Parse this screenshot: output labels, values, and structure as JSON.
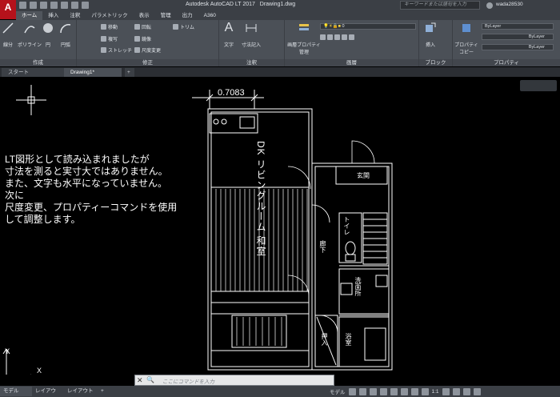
{
  "app": {
    "logo": "A",
    "title": "Autodesk AutoCAD LT 2017",
    "drawing": "Drawing1.dwg",
    "search_placeholder": "キーワードまたは語句を入力",
    "user": "wada28530"
  },
  "ribbon_tabs": [
    "ホーム",
    "挿入",
    "注釈",
    "パラメトリック",
    "表示",
    "管理",
    "出力",
    "A360"
  ],
  "ribbon": {
    "draw": {
      "label": "作成",
      "buttons": [
        "線分",
        "ポリライン",
        "円",
        "円弧"
      ]
    },
    "modify": {
      "label": "修正",
      "items": [
        "移動",
        "回転",
        "トリム",
        "複写",
        "鏡像",
        "ストレッチ",
        "尺度変更"
      ]
    },
    "annotation": {
      "label": "注釈",
      "buttons": [
        "文字",
        "寸法記入"
      ]
    },
    "layers": {
      "label": "画層",
      "button": "画層プロパティ管理",
      "current_layer": "0"
    },
    "block": {
      "label": "ブロック",
      "button": "挿入"
    },
    "properties": {
      "label": "プロパティ",
      "button": "プロパティコピー",
      "bylayer_1": "ByLayer",
      "bylayer_2": "ByLayer",
      "bylayer_3": "ByLayer"
    }
  },
  "file_tabs": {
    "start": "スタート",
    "drawing": "Drawing1*",
    "add": "+"
  },
  "canvas": {
    "dimension": "0.7083",
    "note": "LT図形として読み込まれましたが\n寸法を測ると実寸大ではありません。\nまた、文字も水平になっていません。\n次に\n尺度変更、プロパティーコマンドを使用\nして調整します。",
    "room_dk": "DK リビングルーム 和室",
    "room_entrance": "玄関",
    "room_toilet": "トイレ",
    "room_hall": "廊下",
    "room_washroom": "洗面所",
    "room_closet": "押入",
    "room_bath": "浴室",
    "axis_y": "Y",
    "axis_x": "X"
  },
  "command_line": {
    "close": "✕",
    "search": "🔍",
    "placeholder": "ここにコマンドを入力"
  },
  "status": {
    "tab_model": "モデル",
    "tab_layout1": "レイアウト1",
    "tab_layout2": "レイアウト2",
    "add": "+",
    "model": "モデル",
    "scale": "1:1"
  },
  "colors": {
    "background": "#000000",
    "ribbon": "#4b5057",
    "app_red": "#b5121b"
  }
}
